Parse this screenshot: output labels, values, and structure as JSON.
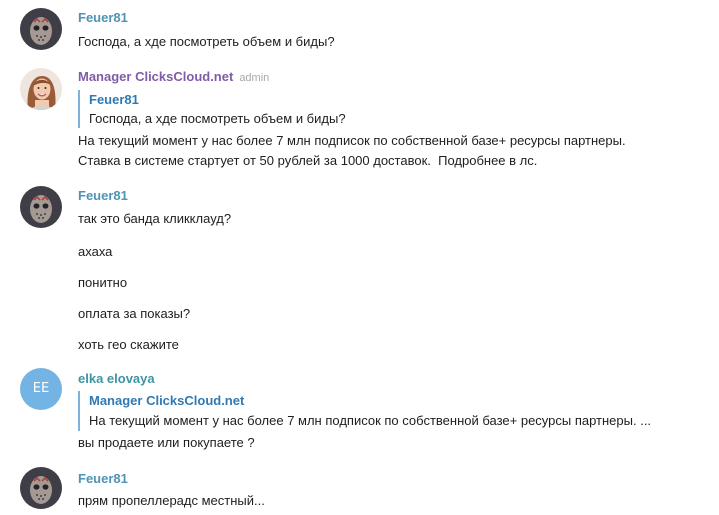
{
  "colors": {
    "name-feuer": "#4f93b5",
    "name-manager": "#7f5ca6",
    "name-elka": "#3d95a3",
    "badge": "#a8a8a8",
    "reply-bar": "#7db2dc",
    "reply-name": "#2f7ab5",
    "avatar-ee": "#74b4e4"
  },
  "messages": [
    {
      "author": "Feuer81",
      "avatar": "hockey-mask-avatar-icon",
      "texts": [
        "Господа, а хде посмотреть объем и биды?"
      ]
    },
    {
      "author": "Manager ClicksCloud.net",
      "badge": "admin",
      "avatar": "woman-photo-avatar-icon",
      "reply": {
        "author": "Feuer81",
        "text": "Господа, а хде посмотреть объем и биды?"
      },
      "texts": [
        "На текущий момент у нас более 7 млн подписок по собственной базе+ ресурсы партнеры.",
        "Ставка в системе стартует от 50 рублей за 1000 доставок.  Подробнее в лс."
      ]
    },
    {
      "author": "Feuer81",
      "avatar": "hockey-mask-avatar-icon",
      "texts": [
        "так это банда кликклауд?",
        "ахаха",
        "понитно",
        "оплата за показы?",
        "хоть гео скажите"
      ]
    },
    {
      "author": "elka elovaya",
      "avatar_initials": "EE",
      "reply": {
        "author": "Manager ClicksCloud.net",
        "text": "На текущий момент у нас более 7 млн подписок по собственной базе+ ресурсы партнеры. ..."
      },
      "texts": [
        "вы продаете или покупаете ?"
      ]
    },
    {
      "author": "Feuer81",
      "avatar": "hockey-mask-avatar-icon",
      "texts": [
        "прям пропеллерадс местный..."
      ]
    }
  ]
}
